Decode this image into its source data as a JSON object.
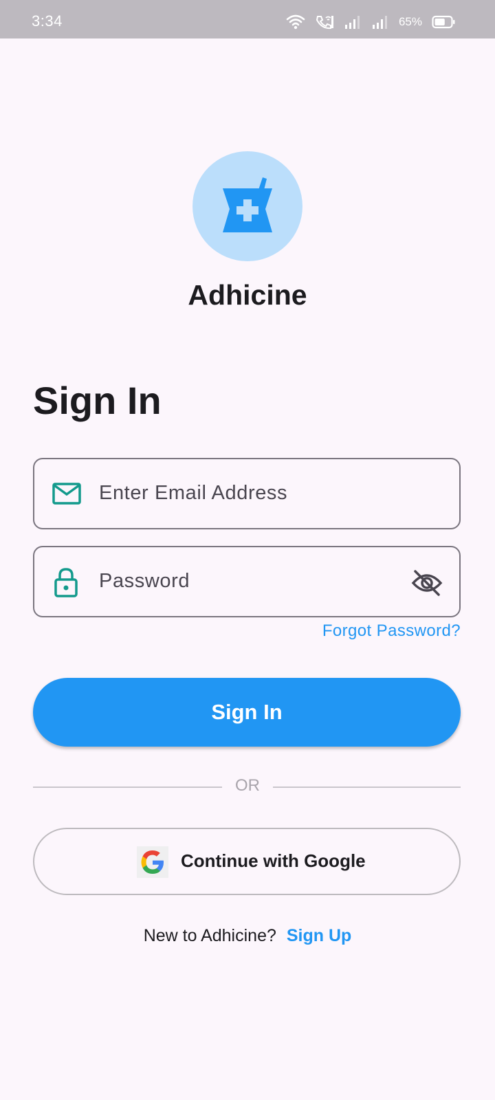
{
  "status_bar": {
    "time": "3:34",
    "battery_percent": "65%",
    "battery_level": 0.65,
    "icons": [
      "wifi-icon",
      "wifi-calling-icon",
      "signal-icon",
      "signal-icon",
      "battery-icon"
    ]
  },
  "app": {
    "name": "Adhicine",
    "logo_icon": "mortar-pestle-icon",
    "accent_color": "#2196f3",
    "logo_bg_color": "#bbdefb"
  },
  "form": {
    "title": "Sign In",
    "email_placeholder": "Enter Email Address",
    "email_icon": "mail-icon",
    "password_placeholder": "Password",
    "password_icon": "lock-icon",
    "visibility_icon": "eye-off-icon",
    "forgot_label": "Forgot Password?",
    "submit_label": "Sign In",
    "icon_color": "#139a8c"
  },
  "divider": {
    "label": "OR"
  },
  "social": {
    "google_label": "Continue with Google",
    "google_icon": "google-icon"
  },
  "footer": {
    "prompt": "New to Adhicine?",
    "signup_label": "Sign Up"
  }
}
